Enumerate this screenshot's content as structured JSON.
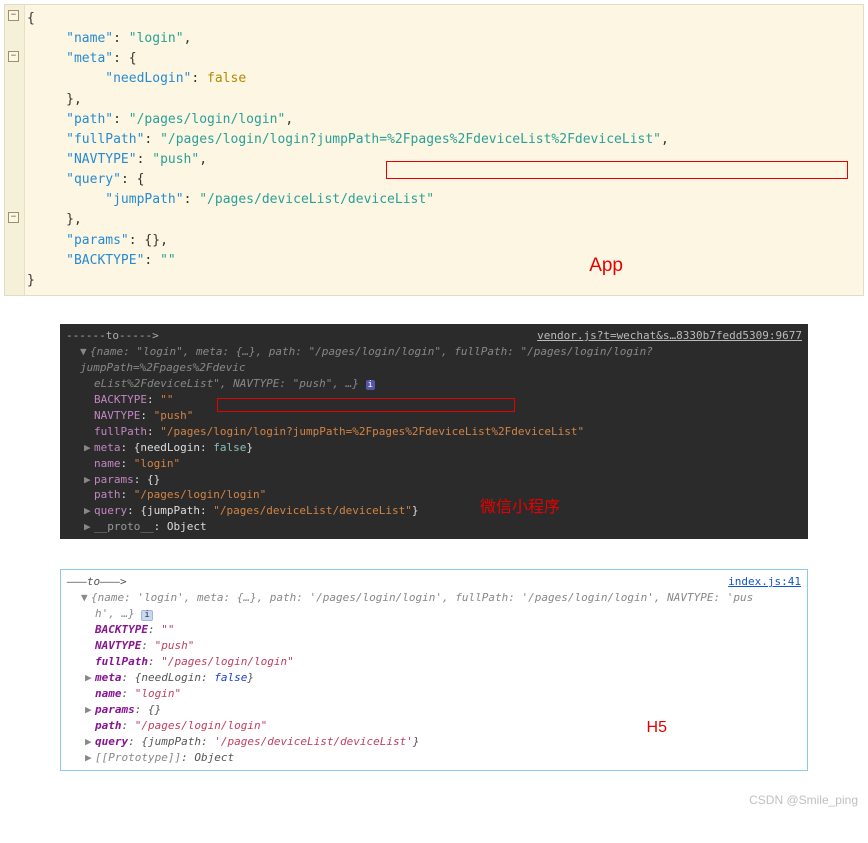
{
  "watermark": "CSDN @Smile_ping",
  "labels": {
    "app": "App",
    "wechat": "微信小程序",
    "h5": "H5"
  },
  "panel1": {
    "name_key": "\"name\"",
    "name_val": "\"login\"",
    "meta_key": "\"meta\"",
    "needLogin_key": "\"needLogin\"",
    "needLogin_val": "false",
    "path_key": "\"path\"",
    "path_val": "\"/pages/login/login\"",
    "fullPath_key": "\"fullPath\"",
    "fullPath_val_a": "\"/pages/login/login",
    "fullPath_val_b": "?jumpPath=%2Fpages%2FdeviceList%2FdeviceList\"",
    "navtype_key": "\"NAVTYPE\"",
    "navtype_val": "\"push\"",
    "query_key": "\"query\"",
    "jumpPath_key": "\"jumpPath\"",
    "jumpPath_val": "\"/pages/deviceList/deviceList\"",
    "params_key": "\"params\"",
    "params_val": "{}",
    "backtype_key": "\"BACKTYPE\"",
    "backtype_val": "\"\""
  },
  "panel2": {
    "header": "------to----->",
    "source": "vendor.js?t=wechat&s…8330b7fedd5309:9677",
    "summary_a": "{name: \"login\", meta: {…}, path: \"/pages/login/login\", fullPath: \"/pages/login/login?jumpPath=%2Fpages%2Fdevic",
    "summary_b": "eList%2FdeviceList\", NAVTYPE: \"push\", …}",
    "backtype_k": "BACKTYPE",
    "backtype_v": "\"\"",
    "navtype_k": "NAVTYPE",
    "navtype_v": "\"push\"",
    "fullPath_k": "fullPath",
    "fullPath_v_a": "\"/pages/login/login",
    "fullPath_v_b": "?jumpPath=%2Fpages%2FdeviceList%2FdeviceList\"",
    "meta_k": "meta",
    "meta_v_pre": "{needLogin: ",
    "meta_v_bool": "false",
    "meta_v_post": "}",
    "name_k": "name",
    "name_v": "\"login\"",
    "params_k": "params",
    "params_v": "{}",
    "path_k": "path",
    "path_v": "\"/pages/login/login\"",
    "query_k": "query",
    "query_v_pre": "{jumpPath: ",
    "query_v": "\"/pages/deviceList/deviceList\"",
    "query_v_post": "}",
    "proto_k": "__proto__",
    "proto_v": "Object"
  },
  "panel3": {
    "header": "———to———>",
    "source": "index.js:41",
    "summary_a": "{name: 'login', meta: {…}, path: '/pages/login/login', fullPath: '/pages/login/login', NAVTYPE: 'pus",
    "summary_b": "h', …}",
    "backtype_k": "BACKTYPE",
    "backtype_v": "\"\"",
    "navtype_k": "NAVTYPE",
    "navtype_v": "\"push\"",
    "fullPath_k": "fullPath",
    "fullPath_v": "\"/pages/login/login\"",
    "meta_k": "meta",
    "meta_v_pre": "{needLogin: ",
    "meta_v_bool": "false",
    "meta_v_post": "}",
    "name_k": "name",
    "name_v": "\"login\"",
    "params_k": "params",
    "params_v": "{}",
    "path_k": "path",
    "path_v": "\"/pages/login/login\"",
    "query_k": "query",
    "query_v_pre": "{jumpPath: ",
    "query_v": "'/pages/deviceList/deviceList'",
    "query_v_post": "}",
    "proto_k": "[[Prototype]]",
    "proto_v": "Object",
    "info_chip": "i"
  }
}
